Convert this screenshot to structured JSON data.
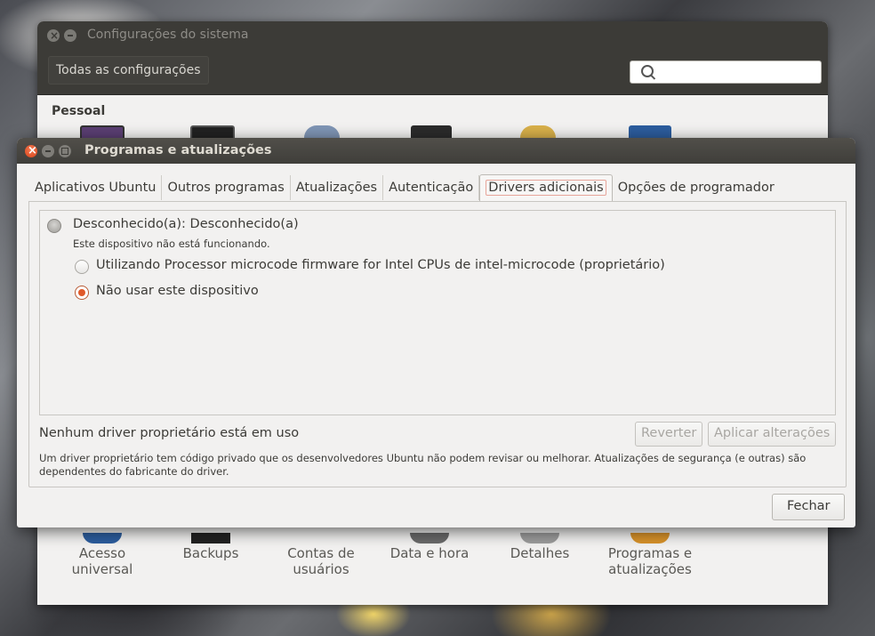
{
  "settings_window": {
    "title": "Configurações do sistema",
    "all_settings_label": "Todas as configurações",
    "search_placeholder": "",
    "section_heading": "Pessoal",
    "bottom_items": [
      "Acesso universal",
      "Backups",
      "Contas de usuários",
      "Data e hora",
      "Detalhes",
      "Programas e atualizações"
    ]
  },
  "dialog": {
    "title": "Programas e atualizações",
    "tabs": [
      {
        "label": "Aplicativos Ubuntu",
        "active": false
      },
      {
        "label": "Outros programas",
        "active": false
      },
      {
        "label": "Atualizações",
        "active": false
      },
      {
        "label": "Autenticação",
        "active": false
      },
      {
        "label": "Drivers adicionais",
        "active": true
      },
      {
        "label": "Opções de programador",
        "active": false
      }
    ],
    "device": {
      "name": "Desconhecido(a): Desconhecido(a)",
      "status": "Este dispositivo não está funcionando.",
      "options": [
        {
          "label": "Utilizando Processor microcode firmware for Intel CPUs de intel-microcode (proprietário)",
          "selected": false
        },
        {
          "label": "Não usar este dispositivo",
          "selected": true
        }
      ]
    },
    "status_text": "Nenhum driver proprietário está em uso",
    "revert_label": "Reverter",
    "apply_label": "Aplicar alterações",
    "note": "Um driver proprietário tem código privado que os desenvolvedores Ubuntu não podem revisar ou melhorar. Atualizações de segurança (e outras) são dependentes do fabricante do driver.",
    "close_label": "Fechar"
  },
  "colors": {
    "titlebar": "#3c3b37",
    "accent_orange": "#e0592a",
    "window_bg": "#f2f1f0"
  }
}
